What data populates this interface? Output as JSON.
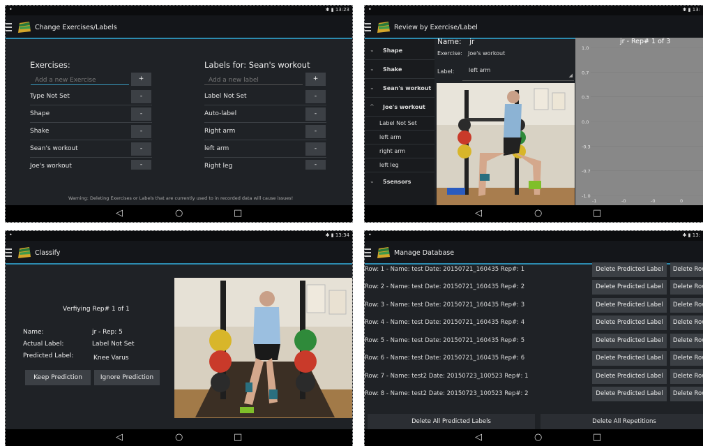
{
  "status": {
    "time1": "13:23",
    "time2": "13:",
    "time3": "13:34",
    "time4": "13:"
  },
  "nav": {
    "back": "◁",
    "home": "○",
    "recent": "□"
  },
  "p1": {
    "title": "Change Exercises/Labels",
    "exercises_heading": "Exercises:",
    "exercise_placeholder": "Add a new Exercise",
    "labels_heading": "Labels for: Sean's workout",
    "label_placeholder": "Add a new label",
    "add_symbol": "+",
    "remove_symbol": "-",
    "exercises": [
      "Type Not Set",
      "Shape",
      "Shake",
      "Sean's workout",
      "Joe's workout"
    ],
    "labels": [
      "Label Not Set",
      "Auto-label",
      "Right arm",
      "left arm",
      "Right leg"
    ],
    "warning": "Warning: Deleting Exercises or Labels that are currently used to in recorded data will cause issues!"
  },
  "p2": {
    "title": "Review by Exercise/Label",
    "drawer": [
      {
        "label": "Shape",
        "chev": "⌄"
      },
      {
        "label": "Shake",
        "chev": "⌄"
      },
      {
        "label": "Sean's workout",
        "chev": "⌄"
      },
      {
        "label": "Joe's workout",
        "chev": "^"
      }
    ],
    "sub_items": [
      "Label Not Set",
      "left arm",
      "right arm",
      "left leg"
    ],
    "last_group": {
      "label": "5sensors",
      "chev": "⌄"
    },
    "name_label": "Name:",
    "name_value": "jr",
    "exercise_label": "Exercise:",
    "exercise_value": "Joe's workout",
    "label_label": "Label:",
    "label_value": "left arm",
    "chart_title": "jr - Rep# 1 of 3",
    "y_ticks": [
      "1.0",
      "0.7",
      "0.3",
      "0.0",
      "-0.3",
      "-0.7",
      "-1.0"
    ],
    "x_ticks": [
      "-1",
      "-0",
      "-0",
      "0"
    ]
  },
  "p3": {
    "title": "Classify",
    "verifying": "Verfiying Rep# 1 of 1",
    "name_label": "Name:",
    "name_value": "jr - Rep: 5",
    "actual_label": "Actual Label:",
    "actual_value": "Label Not Set",
    "predicted_label": "Predicted Label:",
    "predicted_value": "Knee Varus",
    "keep_button": "Keep Prediction",
    "ignore_button": "Ignore Prediction"
  },
  "p4": {
    "title": "Manage Database",
    "rows": [
      "Row: 1 -   Name: test  Date: 20150721_160435  Rep#: 1",
      "Row: 2 -   Name: test  Date: 20150721_160435  Rep#: 2",
      "Row: 3 -   Name: test  Date: 20150721_160435  Rep#: 3",
      "Row: 4 -   Name: test  Date: 20150721_160435  Rep#: 4",
      "Row: 5 -   Name: test  Date: 20150721_160435  Rep#: 5",
      "Row: 6 -   Name: test  Date: 20150721_160435  Rep#: 6",
      "Row: 7 -   Name: test2  Date: 20150723_100523  Rep#: 1",
      "Row: 8 -   Name: test2  Date: 20150723_100523  Rep#: 2"
    ],
    "delete_predicted": "Delete Predicted Label",
    "delete_row": "Delete Row",
    "delete_all_predicted": "Delete All Predicted Labels",
    "delete_all_reps": "Delete All Repetitions"
  }
}
